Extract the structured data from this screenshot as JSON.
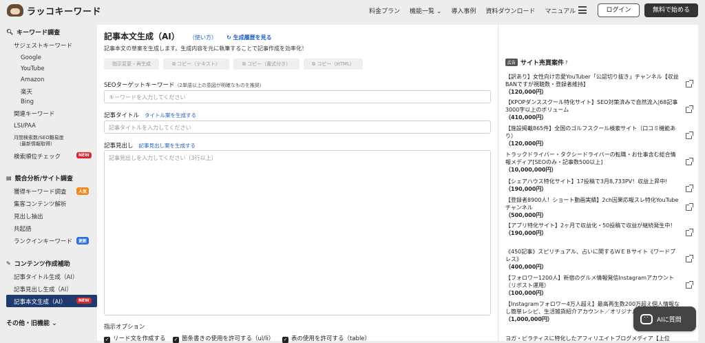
{
  "header": {
    "logo": "ラッコキーワード",
    "nav": [
      "料金プラン",
      "機能一覧 ⌄",
      "導入事例",
      "資料ダウンロード",
      "マニュアル"
    ],
    "login": "ログイン",
    "free": "無料で始める"
  },
  "sidebar": {
    "sec1": "キーワード調査",
    "sec1_items": [
      "サジェストキーワード",
      "Google",
      "YouTube",
      "Amazon",
      "楽天",
      "Bing",
      "関連キーワード",
      "LSI/PAA",
      "月間検索数/SEO難易度",
      "（最新情報取得）",
      "検索順位チェック"
    ],
    "sec2": "競合分析/サイト調査",
    "sec2_items": [
      "獲得キーワード調査",
      "集客コンテンツ解析",
      "見出し抽出",
      "共起語",
      "ランクインキーワード"
    ],
    "sec3": "コンテンツ作成補助",
    "sec3_items": [
      "記事タイトル生成（AI）",
      "記事見出し生成（AI）",
      "記事本文生成（AI）"
    ],
    "sec4": "その他・旧機能 ⌄",
    "badges": {
      "new": "NEW",
      "popular": "人気",
      "update": "更新"
    }
  },
  "main": {
    "title": "記事本文生成（AI）",
    "usage": "（使い方）",
    "history": "生成履歴を見る",
    "desc": "記事本文の草案を生成します。生成内容を元に執筆することで記事作成を効率化！",
    "tools": [
      "指示変更・再生成",
      "コピー（テキスト）",
      "コピー（書式付き）",
      "コピー（HTML）"
    ],
    "seo_label": "SEOターゲットキーワード",
    "seo_note": "（2単語以上の意図が明確なものを推奨）",
    "seo_ph": "キーワードを入力してください",
    "title_label": "記事タイトル",
    "title_link": "タイトル案を生成する",
    "title_ph": "記事タイトルを入力してください",
    "h_label": "記事見出し",
    "h_link": "記事見出し案を生成する",
    "h_ph": "記事見出しを入力してください（3行以上）",
    "options": "指示オプション",
    "checks": [
      "リード文を作成する",
      "箇条書きの使用を許可する（ul/li）",
      "表の使用を許可する（table）"
    ]
  },
  "right": {
    "ad": "広告",
    "title": "サイト売買案件",
    "listings": [
      {
        "t": "【訳あり】女性向け恋愛YouTuber「公認切り抜き」チャンネル【収益BANですが視聴数・登録者維持】",
        "p": "（120,000円）"
      },
      {
        "t": "【KPOPダンススクール特化サイト】SEO対策済みで自然流入|68記事3000字以上のボリューム",
        "p": "（410,000円）"
      },
      {
        "t": "【施設掲載865件】全国のゴルフスクール検索サイト（口コミ機能あり）",
        "p": "（120,000円）"
      },
      {
        "t": "トラックドライバー・タクシードライバーの転職・お仕事含む総合情報メディア[SEOのみ・記事数500以上]",
        "p": "（10,000,000円）"
      },
      {
        "t": "【シェアハウス特化サイト】17投稿で3月8,733PV！収益上昇中!",
        "p": "（190,000円）"
      },
      {
        "t": "【登録者8900人！ショート動画実績】2ch因果応報スレ特化YouTubeチャンネル",
        "p": "（500,000円）"
      },
      {
        "t": "【アプリ特化サイト】2ヶ月で収益化・50投稿で収益が継続発生中！",
        "p": "（190,000円）"
      },
      {
        "t": "《450記事》スピリチュアル、占いに関するＷＥＢサイト《ワードプレス》",
        "p": "（400,000円）"
      },
      {
        "t": "【フォロワー1200人】新宿のグルメ情報発信Instagramアカウント（リポスト運用）",
        "p": "（100,000円）"
      },
      {
        "t": "【Instagramフォロワー4万人超え】最高再生数200万超え個人情報なし簡単レシピ、生活雑貨紹介アカウント／オリジナル",
        "p": "（1,000,000円）"
      },
      {
        "t": "ヨガ・ピラティスに特化したアフィリエイトブログメディア【上位",
        "p": ""
      }
    ]
  },
  "ai_button": "AIに質問"
}
